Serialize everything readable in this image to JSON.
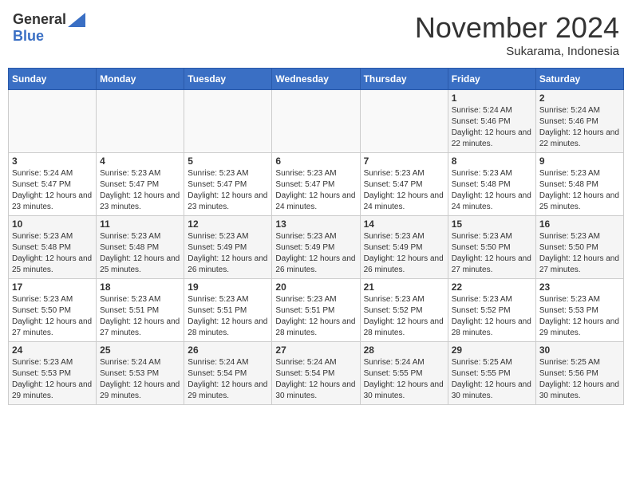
{
  "header": {
    "logo_general": "General",
    "logo_blue": "Blue",
    "month": "November 2024",
    "location": "Sukarama, Indonesia"
  },
  "days_of_week": [
    "Sunday",
    "Monday",
    "Tuesday",
    "Wednesday",
    "Thursday",
    "Friday",
    "Saturday"
  ],
  "weeks": [
    [
      {
        "day": "",
        "info": ""
      },
      {
        "day": "",
        "info": ""
      },
      {
        "day": "",
        "info": ""
      },
      {
        "day": "",
        "info": ""
      },
      {
        "day": "",
        "info": ""
      },
      {
        "day": "1",
        "info": "Sunrise: 5:24 AM\nSunset: 5:46 PM\nDaylight: 12 hours and 22 minutes."
      },
      {
        "day": "2",
        "info": "Sunrise: 5:24 AM\nSunset: 5:46 PM\nDaylight: 12 hours and 22 minutes."
      }
    ],
    [
      {
        "day": "3",
        "info": "Sunrise: 5:24 AM\nSunset: 5:47 PM\nDaylight: 12 hours and 23 minutes."
      },
      {
        "day": "4",
        "info": "Sunrise: 5:23 AM\nSunset: 5:47 PM\nDaylight: 12 hours and 23 minutes."
      },
      {
        "day": "5",
        "info": "Sunrise: 5:23 AM\nSunset: 5:47 PM\nDaylight: 12 hours and 23 minutes."
      },
      {
        "day": "6",
        "info": "Sunrise: 5:23 AM\nSunset: 5:47 PM\nDaylight: 12 hours and 24 minutes."
      },
      {
        "day": "7",
        "info": "Sunrise: 5:23 AM\nSunset: 5:47 PM\nDaylight: 12 hours and 24 minutes."
      },
      {
        "day": "8",
        "info": "Sunrise: 5:23 AM\nSunset: 5:48 PM\nDaylight: 12 hours and 24 minutes."
      },
      {
        "day": "9",
        "info": "Sunrise: 5:23 AM\nSunset: 5:48 PM\nDaylight: 12 hours and 25 minutes."
      }
    ],
    [
      {
        "day": "10",
        "info": "Sunrise: 5:23 AM\nSunset: 5:48 PM\nDaylight: 12 hours and 25 minutes."
      },
      {
        "day": "11",
        "info": "Sunrise: 5:23 AM\nSunset: 5:48 PM\nDaylight: 12 hours and 25 minutes."
      },
      {
        "day": "12",
        "info": "Sunrise: 5:23 AM\nSunset: 5:49 PM\nDaylight: 12 hours and 26 minutes."
      },
      {
        "day": "13",
        "info": "Sunrise: 5:23 AM\nSunset: 5:49 PM\nDaylight: 12 hours and 26 minutes."
      },
      {
        "day": "14",
        "info": "Sunrise: 5:23 AM\nSunset: 5:49 PM\nDaylight: 12 hours and 26 minutes."
      },
      {
        "day": "15",
        "info": "Sunrise: 5:23 AM\nSunset: 5:50 PM\nDaylight: 12 hours and 27 minutes."
      },
      {
        "day": "16",
        "info": "Sunrise: 5:23 AM\nSunset: 5:50 PM\nDaylight: 12 hours and 27 minutes."
      }
    ],
    [
      {
        "day": "17",
        "info": "Sunrise: 5:23 AM\nSunset: 5:50 PM\nDaylight: 12 hours and 27 minutes."
      },
      {
        "day": "18",
        "info": "Sunrise: 5:23 AM\nSunset: 5:51 PM\nDaylight: 12 hours and 27 minutes."
      },
      {
        "day": "19",
        "info": "Sunrise: 5:23 AM\nSunset: 5:51 PM\nDaylight: 12 hours and 28 minutes."
      },
      {
        "day": "20",
        "info": "Sunrise: 5:23 AM\nSunset: 5:51 PM\nDaylight: 12 hours and 28 minutes."
      },
      {
        "day": "21",
        "info": "Sunrise: 5:23 AM\nSunset: 5:52 PM\nDaylight: 12 hours and 28 minutes."
      },
      {
        "day": "22",
        "info": "Sunrise: 5:23 AM\nSunset: 5:52 PM\nDaylight: 12 hours and 28 minutes."
      },
      {
        "day": "23",
        "info": "Sunrise: 5:23 AM\nSunset: 5:53 PM\nDaylight: 12 hours and 29 minutes."
      }
    ],
    [
      {
        "day": "24",
        "info": "Sunrise: 5:23 AM\nSunset: 5:53 PM\nDaylight: 12 hours and 29 minutes."
      },
      {
        "day": "25",
        "info": "Sunrise: 5:24 AM\nSunset: 5:53 PM\nDaylight: 12 hours and 29 minutes."
      },
      {
        "day": "26",
        "info": "Sunrise: 5:24 AM\nSunset: 5:54 PM\nDaylight: 12 hours and 29 minutes."
      },
      {
        "day": "27",
        "info": "Sunrise: 5:24 AM\nSunset: 5:54 PM\nDaylight: 12 hours and 30 minutes."
      },
      {
        "day": "28",
        "info": "Sunrise: 5:24 AM\nSunset: 5:55 PM\nDaylight: 12 hours and 30 minutes."
      },
      {
        "day": "29",
        "info": "Sunrise: 5:25 AM\nSunset: 5:55 PM\nDaylight: 12 hours and 30 minutes."
      },
      {
        "day": "30",
        "info": "Sunrise: 5:25 AM\nSunset: 5:56 PM\nDaylight: 12 hours and 30 minutes."
      }
    ]
  ]
}
